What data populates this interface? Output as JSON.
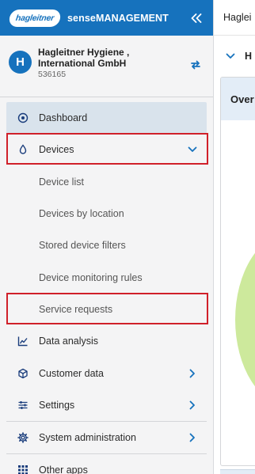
{
  "app": {
    "logo_text": "hagleitner",
    "name": "senseMANAGEMENT"
  },
  "org": {
    "avatar_letter": "H",
    "name": "Hagleitner Hygiene , International GmbH",
    "id": "536165"
  },
  "menu": {
    "dashboard": "Dashboard",
    "devices": "Devices",
    "device_list": "Device list",
    "devices_by_location": "Devices by location",
    "stored_filters": "Stored device filters",
    "monitoring_rules": "Device monitoring rules",
    "service_requests": "Service requests",
    "data_analysis": "Data analysis",
    "customer_data": "Customer data",
    "settings": "Settings",
    "system_admin": "System administration",
    "other_apps": "Other apps"
  },
  "main": {
    "top_title": "Haglei",
    "sub_title": "H",
    "card_title": "Over"
  },
  "colors": {
    "brand": "#1672bd",
    "highlight": "#d0202a",
    "active_bg": "#d9e3ec",
    "chart_fill": "#cde99c"
  }
}
